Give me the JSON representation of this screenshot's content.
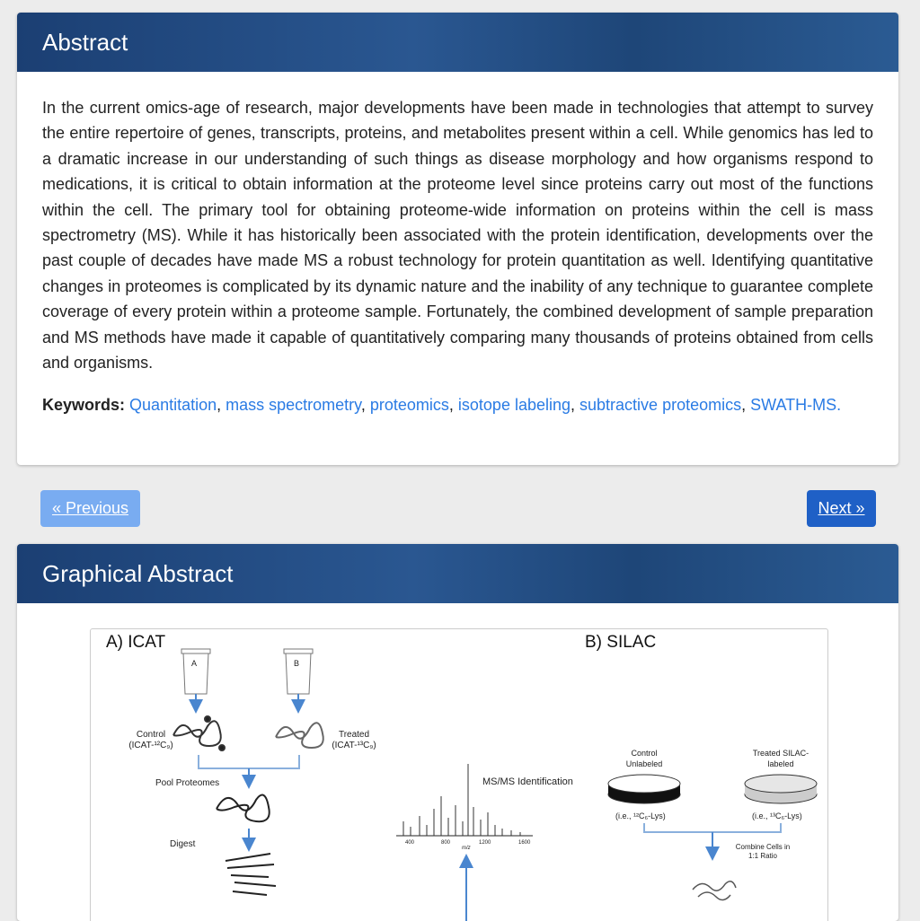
{
  "abstract": {
    "title": "Abstract",
    "text": "In the current omics-age of research, major developments have been made in technologies that attempt to survey the entire repertoire of genes, transcripts, proteins, and metabolites present within a cell. While genomics has led to a dramatic increase in our understanding of such things as disease morphology and how organisms respond to medications, it is critical to obtain information at the proteome level since proteins carry out most of the functions within the cell. The primary tool for obtaining proteome-wide information on proteins within the cell is mass spectrometry (MS). While it has historically been associated with the protein identification, developments over the past couple of decades have made MS a robust technology for protein quantitation as well. Identifying quantitative changes in proteomes is complicated by its dynamic nature and the inability of any technique to guarantee complete coverage of every protein within a proteome sample. Fortunately, the combined development of sample preparation and MS methods have made it capable of quantitatively comparing many thousands of proteins obtained from cells and organisms.",
    "keywords_label": "Keywords:",
    "keywords": [
      "Quantitation",
      "mass spectrometry",
      "proteomics",
      "isotope labeling",
      "subtractive proteomics",
      "SWATH-MS"
    ],
    "sep": ", ",
    "end": "."
  },
  "nav": {
    "previous_label": "« Previous",
    "next_label": "Next »"
  },
  "graphical_abstract": {
    "title": "Graphical Abstract",
    "figure": {
      "panel_a_title": "A) ICAT",
      "panel_b_title": "B) SILAC",
      "tube_a": "A",
      "tube_b": "B",
      "control_label": "Control (ICAT-¹²C₉)",
      "treated_label": "Treated (ICAT-¹³C₉)",
      "pool_label": "Pool Proteomes",
      "digest_label": "Digest",
      "msms_label": "MS/MS Identification",
      "mz_label": "m/z",
      "mz_ticks": [
        "400",
        "800",
        "1200",
        "1600"
      ],
      "silac_control": "Control Unlabeled",
      "silac_treated": "Treated SILAC-labeled",
      "silac_control_iso": "(i.e., ¹²C₆-Lys)",
      "silac_treated_iso": "(i.e., ¹³C₆-Lys)",
      "combine_label": "Combine Cells in 1:1 Ratio"
    }
  },
  "colors": {
    "header_blue": "#1b3f73",
    "link": "#2a7be4",
    "prev_button": "#79acf1",
    "next_button": "#1f60c6",
    "arrow_blue": "#4a86cf"
  }
}
